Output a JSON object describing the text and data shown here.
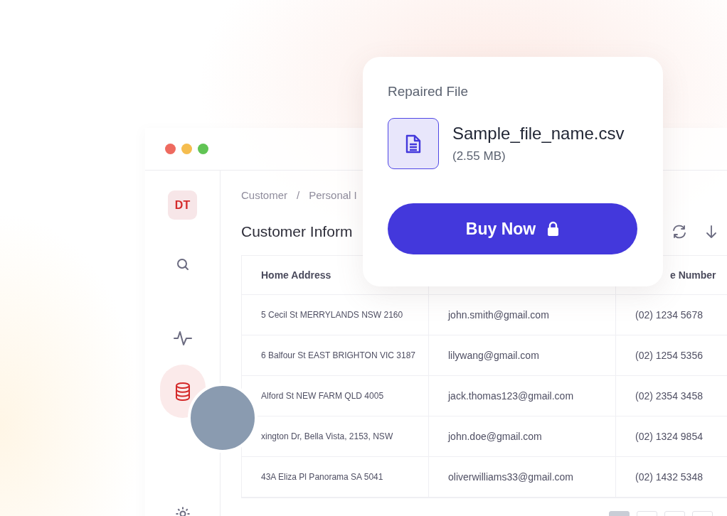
{
  "sidebar": {
    "badge": "DT",
    "items": [
      {
        "kind": "search",
        "selected": false
      },
      {
        "kind": "activity",
        "selected": false
      },
      {
        "kind": "database",
        "selected": true
      },
      {
        "kind": "settings",
        "selected": false
      }
    ]
  },
  "breadcrumb": [
    "Customer",
    "Personal I"
  ],
  "breadcrumb_separator": "/",
  "page_title": "Customer Inform",
  "table": {
    "columns": [
      "Home Address",
      "",
      "e Number"
    ],
    "rows": [
      [
        "5 Cecil St MERRYLANDS NSW 2160",
        "john.smith@gmail.com",
        "(02) 1234 5678"
      ],
      [
        "6 Balfour St EAST BRIGHTON VIC 3187",
        "lilywang@gmail.com",
        "(02) 1254 5356"
      ],
      [
        "Alford St NEW FARM QLD 4005",
        "jack.thomas123@gmail.com",
        "(02) 2354 3458"
      ],
      [
        "xington Dr, Bella Vista, 2153, NSW",
        "john.doe@gmail.com",
        "(02) 1324 9854"
      ],
      [
        "43A Eliza Pl  Panorama SA 5041",
        "oliverwilliams33@gmail.com",
        "(02) 1432 5348"
      ]
    ]
  },
  "pagination": [
    {
      "selected": true
    },
    {
      "selected": false
    },
    {
      "selected": false
    },
    {
      "selected": false
    }
  ],
  "repaired_file_card": {
    "title": "Repaired File",
    "file_name": "Sample_file_name.csv",
    "file_size": "(2.55 MB)",
    "button": "Buy Now"
  }
}
